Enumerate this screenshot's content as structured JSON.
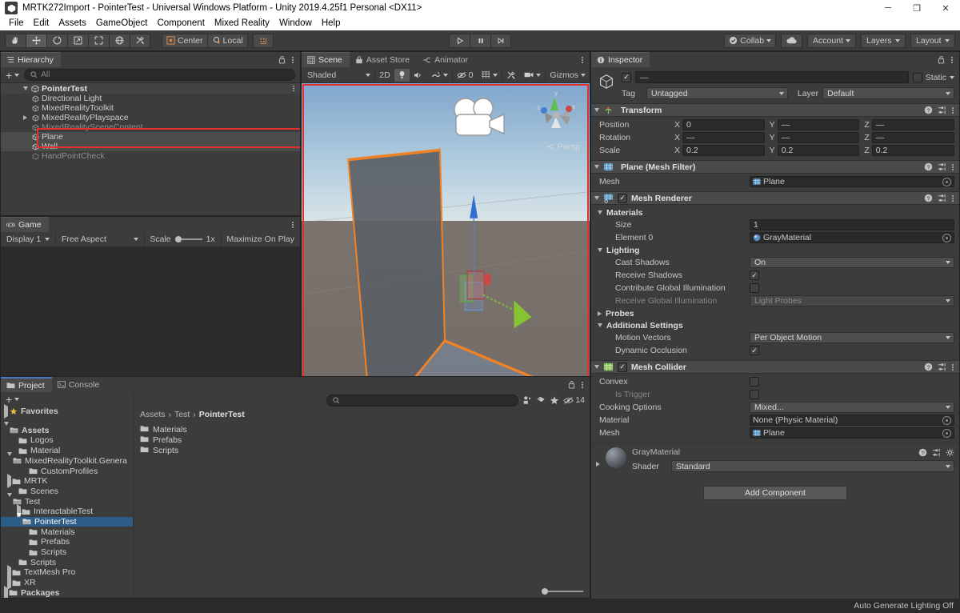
{
  "window": {
    "title": "MRTK272Import - PointerTest - Universal Windows Platform - Unity 2019.4.25f1 Personal <DX11>",
    "app_icon": "unity-icon",
    "minimize": "─",
    "maximize": "❐",
    "close": "✕"
  },
  "menubar": {
    "items": [
      "File",
      "Edit",
      "Assets",
      "GameObject",
      "Component",
      "Mixed Reality",
      "Window",
      "Help"
    ]
  },
  "toolbar": {
    "tools": [
      {
        "name": "hand-tool",
        "icon": "hand-icon",
        "active": false
      },
      {
        "name": "move-tool",
        "icon": "move-icon",
        "active": true
      },
      {
        "name": "rotate-tool",
        "icon": "rotate-icon",
        "active": false
      },
      {
        "name": "scale-tool",
        "icon": "scale-icon",
        "active": false
      },
      {
        "name": "rect-tool",
        "icon": "rect-icon",
        "active": false
      },
      {
        "name": "transform-tool",
        "icon": "transform-icon",
        "active": false
      },
      {
        "name": "custom-tool",
        "icon": "wrench-icon",
        "active": false
      }
    ],
    "pivot_mode": "Center",
    "pivot_rotation": "Local",
    "play_buttons": [
      "▶",
      "❙❙",
      "▶❙"
    ],
    "collab": "Collab",
    "cloud_icon": "cloud-icon",
    "account": "Account",
    "layers": "Layers",
    "layout": "Layout"
  },
  "hierarchy": {
    "tab": "Hierarchy",
    "tab_icon": "hierarchy-icon",
    "add_label": "+",
    "search_placeholder": "All",
    "items": [
      {
        "label": "PointerTest",
        "depth": 1,
        "twist": "down",
        "icon": "scene-icon",
        "selected": false,
        "root": true
      },
      {
        "label": "Directional Light",
        "depth": 2,
        "twist": "none",
        "icon": "gameobject-icon",
        "selected": false
      },
      {
        "label": "MixedRealityToolkit",
        "depth": 2,
        "twist": "none",
        "icon": "gameobject-icon",
        "selected": false
      },
      {
        "label": "MixedRealityPlayspace",
        "depth": 2,
        "twist": "right",
        "icon": "gameobject-icon",
        "selected": false
      },
      {
        "label": "MixedRealitySceneContent",
        "depth": 2,
        "twist": "none",
        "icon": "gameobject-icon",
        "selected": false
      },
      {
        "label": "Plane",
        "depth": 2,
        "twist": "none",
        "icon": "gameobject-icon",
        "selected": true
      },
      {
        "label": "Wall",
        "depth": 2,
        "twist": "none",
        "icon": "gameobject-icon",
        "selected": true
      },
      {
        "label": "HandPointCheck",
        "depth": 2,
        "twist": "none",
        "icon": "gameobject-icon",
        "selected": false,
        "dim": true
      }
    ]
  },
  "game": {
    "tab": "Game",
    "tab_icon": "game-icon",
    "display": "Display 1",
    "aspect": "Free Aspect",
    "scale_label": "Scale",
    "scale_value": "1x",
    "maximize": "Maximize On Play"
  },
  "scene": {
    "tabs": [
      {
        "label": "Scene",
        "icon": "scene-grid-icon",
        "active": true
      },
      {
        "label": "Asset Store",
        "icon": "store-icon",
        "active": false
      },
      {
        "label": "Animator",
        "icon": "animator-icon",
        "active": false
      }
    ],
    "draw_mode": "Shaded",
    "two_d": "2D",
    "lighting_icon": "lightbulb-icon",
    "audio_icon": "audio-icon",
    "fx_icon": "fx-icon",
    "hidden_count": "0",
    "grid_icon": "grid-icon",
    "tools_icon": "component-tools-icon",
    "camera_icon": "scene-camera-icon",
    "gizmos": "Gizmos",
    "perspective_label": "Persp",
    "gizmo_axes": [
      "y",
      "x",
      "z"
    ]
  },
  "project": {
    "tabs": [
      {
        "label": "Project",
        "icon": "project-icon",
        "active": true
      },
      {
        "label": "Console",
        "icon": "console-icon",
        "active": false
      }
    ],
    "add_label": "+",
    "search_placeholder": "",
    "hidden_count": "14",
    "breadcrumb": [
      "Assets",
      "Test",
      "PointerTest"
    ],
    "tree": [
      {
        "label": "Favorites",
        "depth": 0,
        "twist": "right",
        "icon": "star-icon",
        "bold": true,
        "selected": false
      },
      {
        "label": "",
        "depth": 0,
        "twist": "none",
        "icon": "none",
        "spacer": true,
        "selected": false
      },
      {
        "label": "Assets",
        "depth": 0,
        "twist": "down",
        "icon": "folder-open-icon",
        "bold": true,
        "selected": false
      },
      {
        "label": "Logos",
        "depth": 1,
        "twist": "none",
        "icon": "folder-icon",
        "selected": false
      },
      {
        "label": "Material",
        "depth": 1,
        "twist": "none",
        "icon": "folder-icon",
        "selected": false
      },
      {
        "label": "MixedRealityToolkit.Genera",
        "depth": 1,
        "twist": "down",
        "icon": "folder-open-icon",
        "selected": false
      },
      {
        "label": "CustomProfiles",
        "depth": 2,
        "twist": "none",
        "icon": "folder-icon",
        "selected": false
      },
      {
        "label": "MRTK",
        "depth": 1,
        "twist": "right",
        "icon": "folder-icon",
        "selected": false
      },
      {
        "label": "Scenes",
        "depth": 1,
        "twist": "none",
        "icon": "folder-icon",
        "selected": false
      },
      {
        "label": "Test",
        "depth": 1,
        "twist": "down",
        "icon": "folder-open-icon",
        "selected": false
      },
      {
        "label": "InteractableTest",
        "depth": 2,
        "twist": "right",
        "icon": "folder-icon",
        "selected": false
      },
      {
        "label": "PointerTest",
        "depth": 2,
        "twist": "down",
        "icon": "folder-open-icon",
        "selected": true
      },
      {
        "label": "Materials",
        "depth": 3,
        "twist": "none",
        "icon": "folder-icon",
        "selected": false
      },
      {
        "label": "Prefabs",
        "depth": 3,
        "twist": "none",
        "icon": "folder-icon",
        "selected": false
      },
      {
        "label": "Scripts",
        "depth": 3,
        "twist": "none",
        "icon": "folder-icon",
        "selected": false
      },
      {
        "label": "Scripts",
        "depth": 1,
        "twist": "none",
        "icon": "folder-icon",
        "selected": false
      },
      {
        "label": "TextMesh Pro",
        "depth": 1,
        "twist": "right",
        "icon": "folder-icon",
        "selected": false
      },
      {
        "label": "XR",
        "depth": 1,
        "twist": "right",
        "icon": "folder-icon",
        "selected": false
      },
      {
        "label": "Packages",
        "depth": 0,
        "twist": "right",
        "icon": "folder-icon",
        "bold": true,
        "selected": false
      }
    ],
    "contents": [
      {
        "label": "Materials",
        "icon": "folder-icon"
      },
      {
        "label": "Prefabs",
        "icon": "folder-icon"
      },
      {
        "label": "Scripts",
        "icon": "folder-icon"
      }
    ]
  },
  "inspector": {
    "tab": "Inspector",
    "tab_icon": "info-icon",
    "object_enabled": true,
    "object_name": "—",
    "static_label": "Static",
    "tag_label": "Tag",
    "tag_value": "Untagged",
    "layer_label": "Layer",
    "layer_value": "Default",
    "transform": {
      "title": "Transform",
      "icon": "transform-axis-icon",
      "rows": [
        {
          "label": "Position",
          "x": "0",
          "y": "—",
          "z": "—"
        },
        {
          "label": "Rotation",
          "x": "—",
          "y": "—",
          "z": "—"
        },
        {
          "label": "Scale",
          "x": "0.2",
          "y": "0.2",
          "z": "0.2"
        }
      ],
      "axis_labels": [
        "X",
        "Y",
        "Z"
      ]
    },
    "mesh_filter": {
      "title": "Plane (Mesh Filter)",
      "icon": "mesh-filter-icon",
      "mesh_label": "Mesh",
      "mesh_value": "Plane"
    },
    "mesh_renderer": {
      "title": "Mesh Renderer",
      "icon": "mesh-renderer-icon",
      "enabled": true,
      "materials_header": "Materials",
      "size_label": "Size",
      "size_value": "1",
      "element_label": "Element 0",
      "element_value": "GrayMaterial",
      "lighting_header": "Lighting",
      "cast_shadows_label": "Cast Shadows",
      "cast_shadows_value": "On",
      "receive_shadows_label": "Receive Shadows",
      "receive_shadows_value": true,
      "contribute_gi_label": "Contribute Global Illumination",
      "contribute_gi_value": false,
      "receive_gi_label": "Receive Global Illumination",
      "receive_gi_value": "Light Probes",
      "probes_header": "Probes",
      "additional_header": "Additional Settings",
      "motion_vectors_label": "Motion Vectors",
      "motion_vectors_value": "Per Object Motion",
      "dynamic_occlusion_label": "Dynamic Occlusion",
      "dynamic_occlusion_value": true
    },
    "mesh_collider": {
      "title": "Mesh Collider",
      "icon": "mesh-collider-icon",
      "enabled": true,
      "convex_label": "Convex",
      "convex_value": false,
      "is_trigger_label": "Is Trigger",
      "is_trigger_value": false,
      "cooking_label": "Cooking Options",
      "cooking_value": "Mixed...",
      "material_label": "Material",
      "material_value": "None (Physic Material)",
      "mesh_label": "Mesh",
      "mesh_value": "Plane"
    },
    "material": {
      "name": "GrayMaterial",
      "shader_label": "Shader",
      "shader_value": "Standard"
    },
    "add_component": "Add Component"
  },
  "statusbar": {
    "text": "Auto Generate Lighting Off"
  },
  "colors": {
    "accent_selection": "#2c5d87",
    "annotation_red": "#e03030",
    "outline_orange": "#f08226",
    "panel_bg": "#3c3c3c",
    "toolbar_bg": "#3c3c3c"
  }
}
